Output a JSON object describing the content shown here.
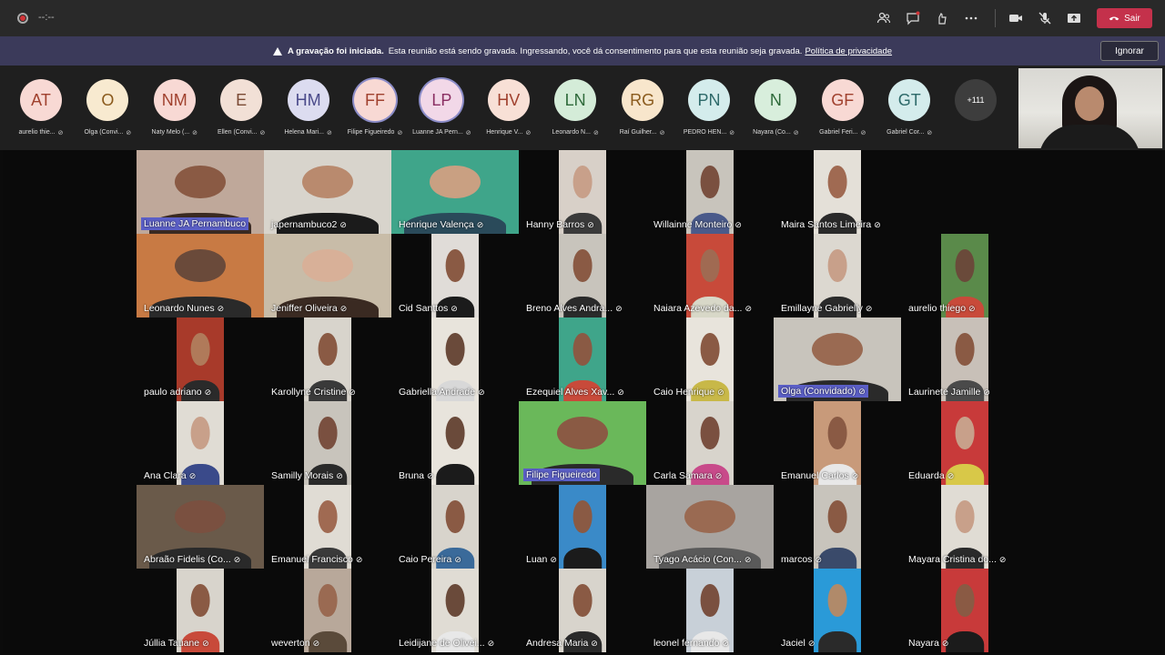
{
  "topbar": {
    "timer": "--:--",
    "leave_label": "Sair",
    "colors": {
      "leave": "#c4314b",
      "bar": "#292929"
    }
  },
  "banner": {
    "title": "A gravação foi iniciada.",
    "message": "Esta reunião está sendo gravada. Ingressando, você dá consentimento para que esta reunião seja gravada.",
    "link": "Política de privacidade",
    "ignore_label": "Ignorar"
  },
  "roster": {
    "avatars": [
      {
        "initials": "AT",
        "name": "aurelio thie...",
        "bg": "#f8d9d4",
        "fg": "#a0412e"
      },
      {
        "initials": "O",
        "name": "Olga (Convi...",
        "bg": "#f8ead0",
        "fg": "#8a5a1c"
      },
      {
        "initials": "NM",
        "name": "Naty Melo (...",
        "bg": "#f8d9d4",
        "fg": "#a0412e"
      },
      {
        "initials": "E",
        "name": "Ellen (Convi...",
        "bg": "#f2e0d6",
        "fg": "#7a4a34"
      },
      {
        "initials": "HM",
        "name": "Helena Mari...",
        "bg": "#dcdcf0",
        "fg": "#4a4a8a"
      },
      {
        "initials": "FF",
        "name": "Filipe Figueiredo",
        "bg": "#f8d9d4",
        "fg": "#a0412e",
        "active": true
      },
      {
        "initials": "LP",
        "name": "Luanne JA Pern...",
        "bg": "#f2d8e8",
        "fg": "#8a2e62",
        "active": true
      },
      {
        "initials": "HV",
        "name": "Henrique V...",
        "bg": "#f8e0d6",
        "fg": "#a0412e"
      },
      {
        "initials": "LN",
        "name": "Leonardo N...",
        "bg": "#d4ecd8",
        "fg": "#2e6a3a"
      },
      {
        "initials": "RG",
        "name": "Raí Guilher...",
        "bg": "#f8e6cc",
        "fg": "#8a5a1c"
      },
      {
        "initials": "PN",
        "name": "PEDRO HEN...",
        "bg": "#d4ecec",
        "fg": "#2e6a6a"
      },
      {
        "initials": "N",
        "name": "Nayara (Co...",
        "bg": "#d8eedc",
        "fg": "#2e6a3a"
      },
      {
        "initials": "GF",
        "name": "Gabriel Feri...",
        "bg": "#f8d9d4",
        "fg": "#a0412e"
      },
      {
        "initials": "GT",
        "name": "Gabriel Cor...",
        "bg": "#d4ecec",
        "fg": "#2e6a6a"
      }
    ],
    "more_count": "+111"
  },
  "grid": {
    "tiles": [
      {
        "name": "Luanne JA Pernambuco",
        "col": 0,
        "row": 0,
        "wide": true,
        "bg": "#bfa89a",
        "skin": "#8a5a44",
        "shirt": "#3a2a22",
        "hl": true,
        "mic": false
      },
      {
        "name": "japernambuco2",
        "col": 1,
        "row": 0,
        "wide": true,
        "bg": "#d8d4cc",
        "skin": "#b98a6e",
        "shirt": "#1b1b1b",
        "mic": true
      },
      {
        "name": "Henrique Valença",
        "col": 2,
        "row": 0,
        "wide": true,
        "bg": "#3fa58a",
        "skin": "#c9a082",
        "shirt": "#2a4a5a",
        "mic": true
      },
      {
        "name": "Hanny Barros",
        "col": 3,
        "row": 0,
        "bg": "#d8d0c8",
        "skin": "#c8a08a",
        "shirt": "#3a3a3a",
        "mic": true
      },
      {
        "name": "Willainne Monteiro",
        "col": 4,
        "row": 0,
        "bg": "#c8c4bc",
        "skin": "#7a5040",
        "shirt": "#4a5a8a",
        "mic": true
      },
      {
        "name": "Maira Santos Limeira",
        "col": 5,
        "row": 0,
        "bg": "#e4e0d8",
        "skin": "#a06a52",
        "shirt": "#2a2a2a",
        "mic": true
      },
      {
        "name": "Leonardo Nunes",
        "col": 0,
        "row": 1,
        "wide": true,
        "bg": "#c87a44",
        "skin": "#6a4a3a",
        "shirt": "#2a2a2a",
        "mic": true
      },
      {
        "name": "Jeniffer Oliveira",
        "col": 1,
        "row": 1,
        "wide": true,
        "bg": "#c8bca8",
        "skin": "#d8b098",
        "shirt": "#3a2a22",
        "mic": true
      },
      {
        "name": "Cid Santtos",
        "col": 2,
        "row": 1,
        "bg": "#e0dcd8",
        "skin": "#8a5a44",
        "shirt": "#1b1b1b",
        "mic": true
      },
      {
        "name": "Breno Alves Andra...",
        "col": 3,
        "row": 1,
        "bg": "#c8c4bc",
        "skin": "#8a5a44",
        "shirt": "#2a2a2a",
        "mic": true
      },
      {
        "name": "Naiara Azevedo da...",
        "col": 4,
        "row": 1,
        "bg": "#c84a3a",
        "skin": "#a06a52",
        "shirt": "#d8d8c8",
        "mic": true
      },
      {
        "name": "Emillayne Gabrielly",
        "col": 5,
        "row": 1,
        "bg": "#dcd8d0",
        "skin": "#c8a08a",
        "shirt": "#2a2a2a",
        "mic": true
      },
      {
        "name": "aurelio thiego",
        "col": 6,
        "row": 1,
        "bg": "#5a8a4a",
        "skin": "#6a4a3a",
        "shirt": "#c84a3a",
        "mic": true
      },
      {
        "name": "paulo adriano",
        "col": 0,
        "row": 2,
        "bg": "#a83a2a",
        "skin": "#b07a5a",
        "shirt": "#2a2a2a",
        "mic": true
      },
      {
        "name": "Karollyne Cristine",
        "col": 1,
        "row": 2,
        "bg": "#d8d4cc",
        "skin": "#8a5a44",
        "shirt": "#3a3a3a",
        "mic": true
      },
      {
        "name": "Gabriella Andrade",
        "col": 2,
        "row": 2,
        "bg": "#e8e4dc",
        "skin": "#6a4a3a",
        "shirt": "#d8d8d8",
        "mic": true
      },
      {
        "name": "Ezequiel Alves Xav...",
        "col": 3,
        "row": 2,
        "bg": "#3fa58a",
        "skin": "#8a5a44",
        "shirt": "#c84a3a",
        "mic": true
      },
      {
        "name": "Caio Henrique",
        "col": 4,
        "row": 2,
        "bg": "#e8e4dc",
        "skin": "#8a5a44",
        "shirt": "#c8b848",
        "mic": true
      },
      {
        "name": "Olga (Convidado)",
        "col": 5,
        "row": 2,
        "wide": true,
        "bg": "#c8c4bc",
        "skin": "#9a6a52",
        "shirt": "#2a2a2a",
        "hl": true,
        "mic": true
      },
      {
        "name": "Laurinete Jamille",
        "col": 6,
        "row": 2,
        "bg": "#c8c0b8",
        "skin": "#8a5a44",
        "shirt": "#4a4a4a",
        "mic": true
      },
      {
        "name": "Ana Clara",
        "col": 0,
        "row": 3,
        "bg": "#e0dcd4",
        "skin": "#c8a08a",
        "shirt": "#3a4a8a",
        "mic": true
      },
      {
        "name": "Samilly Morais",
        "col": 1,
        "row": 3,
        "bg": "#c8c4bc",
        "skin": "#7a5040",
        "shirt": "#2a2a2a",
        "mic": true
      },
      {
        "name": "Bruna",
        "col": 2,
        "row": 3,
        "bg": "#e8e4dc",
        "skin": "#6a4a3a",
        "shirt": "#1b1b1b",
        "mic": true
      },
      {
        "name": "Filipe Figueiredo",
        "col": 3,
        "row": 3,
        "wide": true,
        "bg": "#6ab85a",
        "skin": "#8a5a44",
        "shirt": "#2a2a2a",
        "hl": true,
        "mic": false
      },
      {
        "name": "Carla Samara",
        "col": 4,
        "row": 3,
        "bg": "#d8d4cc",
        "skin": "#7a5040",
        "shirt": "#c84a8a",
        "mic": true
      },
      {
        "name": "Emanuel Carlos",
        "col": 5,
        "row": 3,
        "bg": "#c89a7a",
        "skin": "#8a5a44",
        "shirt": "#e8e8e8",
        "mic": true
      },
      {
        "name": "Eduarda",
        "col": 6,
        "row": 3,
        "bg": "#c83a3a",
        "skin": "#c8a08a",
        "shirt": "#d8c848",
        "mic": true
      },
      {
        "name": "Abraão Fidelis (Co...",
        "col": 0,
        "row": 4,
        "wide": true,
        "bg": "#6a5a4a",
        "skin": "#7a5040",
        "shirt": "#2a2a2a",
        "mic": true
      },
      {
        "name": "Emanuel Francisco",
        "col": 1,
        "row": 4,
        "bg": "#e0dcd4",
        "skin": "#a06a52",
        "shirt": "#3a3a3a",
        "mic": true
      },
      {
        "name": "Caio Pereira",
        "col": 2,
        "row": 4,
        "bg": "#d8d4cc",
        "skin": "#8a5a44",
        "shirt": "#3a6a9a",
        "mic": true
      },
      {
        "name": "Luan",
        "col": 3,
        "row": 4,
        "bg": "#3a8ac8",
        "skin": "#8a5a44",
        "shirt": "#1b1b1b",
        "mic": true
      },
      {
        "name": "Tyago Acácio (Con...",
        "col": 4,
        "row": 4,
        "wide": true,
        "bg": "#a8a4a0",
        "skin": "#9a6a52",
        "shirt": "#5a5a5a",
        "mic": true
      },
      {
        "name": "marcos",
        "col": 5,
        "row": 4,
        "bg": "#c8c4bc",
        "skin": "#8a5a44",
        "shirt": "#3a4a6a",
        "mic": true
      },
      {
        "name": "Mayara Cristina do...",
        "col": 6,
        "row": 4,
        "bg": "#e0dcd4",
        "skin": "#c8a08a",
        "shirt": "#2a2a2a",
        "mic": true
      },
      {
        "name": "Júllia Tauane",
        "col": 0,
        "row": 5,
        "bg": "#d8d4cc",
        "skin": "#8a5a44",
        "shirt": "#c84a3a",
        "mic": true
      },
      {
        "name": "weverton",
        "col": 1,
        "row": 5,
        "bg": "#b8a89a",
        "skin": "#9a6a52",
        "shirt": "#5a4a3a",
        "mic": true
      },
      {
        "name": "Leidijane de Olivei...",
        "col": 2,
        "row": 5,
        "bg": "#e0dcd4",
        "skin": "#6a4a3a",
        "shirt": "#e8e8e8",
        "mic": true
      },
      {
        "name": "Andresa Maria",
        "col": 3,
        "row": 5,
        "bg": "#d8d4cc",
        "skin": "#8a5a44",
        "shirt": "#2a2a2a",
        "mic": true
      },
      {
        "name": "leonel fernando",
        "col": 4,
        "row": 5,
        "bg": "#c8d0d8",
        "skin": "#7a5040",
        "shirt": "#e8e8e8",
        "mic": true
      },
      {
        "name": "Jaciel",
        "col": 5,
        "row": 5,
        "bg": "#2a9ad8",
        "skin": "#b08a6a",
        "shirt": "#2a2a2a",
        "mic": true
      },
      {
        "name": "Nayara",
        "col": 6,
        "row": 5,
        "bg": "#c83a3a",
        "skin": "#8a5a44",
        "shirt": "#1b1b1b",
        "mic": true
      }
    ]
  }
}
